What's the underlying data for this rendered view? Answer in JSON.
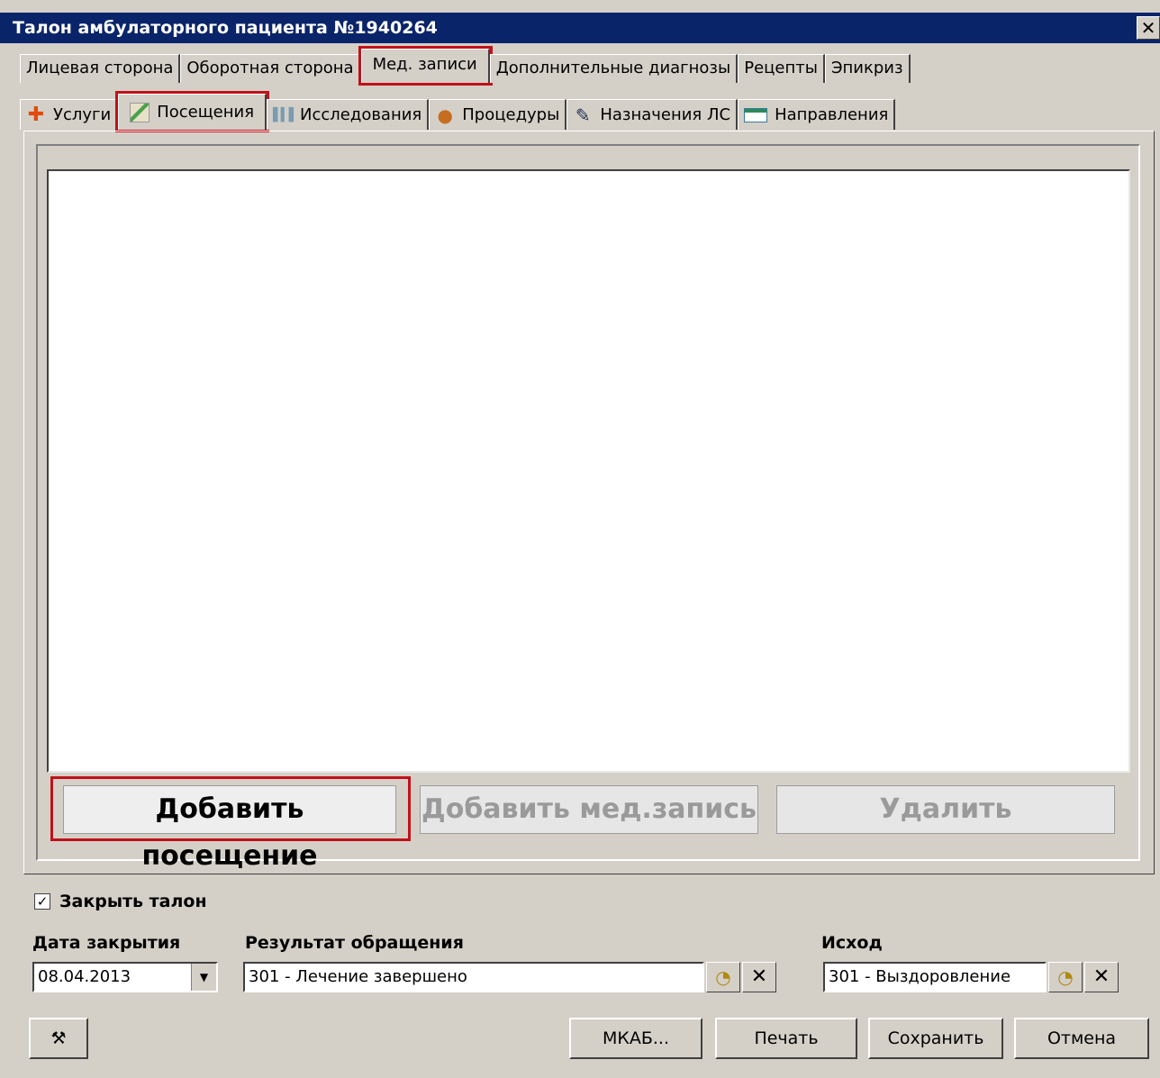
{
  "window": {
    "title": "Талон амбулаторного пациента №1940264",
    "close_glyph": "✕"
  },
  "tabs_top": [
    {
      "label": "Лицевая сторона"
    },
    {
      "label": "Оборотная сторона"
    },
    {
      "label": "Мед. записи",
      "active": true
    },
    {
      "label": "Дополнительные диагнозы"
    },
    {
      "label": "Рецепты"
    },
    {
      "label": "Эпикриз"
    }
  ],
  "tabs_sub": [
    {
      "label": "Услуги",
      "icon": "medical-cross-icon"
    },
    {
      "label": "Посещения",
      "icon": "visit-icon",
      "active": true
    },
    {
      "label": "Исследования",
      "icon": "chart-bars-icon"
    },
    {
      "label": "Процедуры",
      "icon": "person-icon"
    },
    {
      "label": "Назначения ЛС",
      "icon": "syringe-icon"
    },
    {
      "label": "Направления",
      "icon": "document-icon"
    }
  ],
  "actions": {
    "add_visit": "Добавить посещение",
    "add_record": "Добавить мед.запись",
    "delete": "Удалить"
  },
  "close_ticket": {
    "label": "Закрыть талон",
    "checked": true,
    "check_glyph": "✓"
  },
  "close_date": {
    "label": "Дата закрытия",
    "value": "08.04.2013"
  },
  "result": {
    "label": "Результат обращения",
    "value": "301 - Лечение завершено"
  },
  "outcome": {
    "label": "Исход",
    "value": "301 - Выздоровление"
  },
  "bottom_buttons": {
    "mkab": "МКАБ...",
    "print": "Печать",
    "save": "Сохранить",
    "cancel": "Отмена"
  },
  "colors": {
    "highlight": "#c0111a",
    "titlebar": "#0a246a",
    "window_bg": "#d4d0c8"
  }
}
